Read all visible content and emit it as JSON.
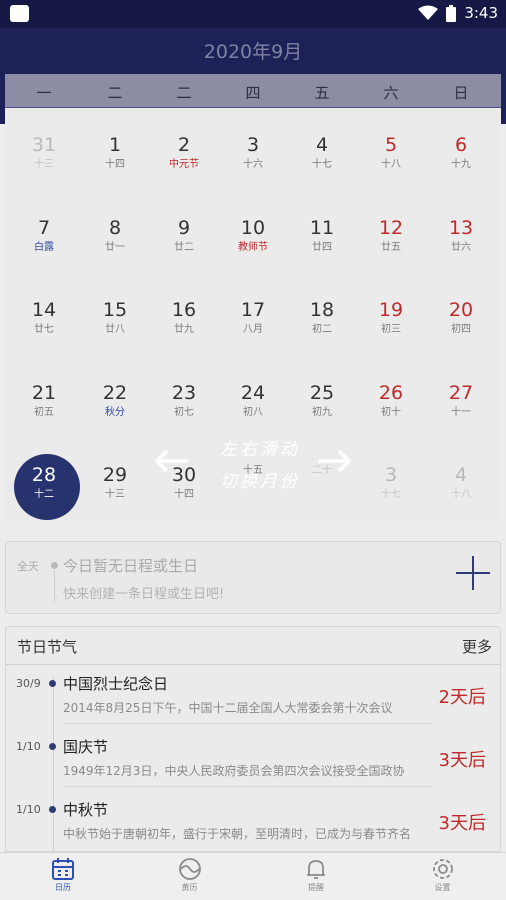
{
  "status": {
    "time": "3:43"
  },
  "header": {
    "month_title": "2020年9月"
  },
  "weekdays": [
    "一",
    "二",
    "二",
    "四",
    "五",
    "六",
    "日"
  ],
  "days": [
    {
      "num": "31",
      "sub": "十三",
      "other": true
    },
    {
      "num": "1",
      "sub": "十四"
    },
    {
      "num": "2",
      "sub": "中元节",
      "sub_style": "festival"
    },
    {
      "num": "3",
      "sub": "十六"
    },
    {
      "num": "4",
      "sub": "十七"
    },
    {
      "num": "5",
      "sub": "十八",
      "weekend": true
    },
    {
      "num": "6",
      "sub": "十九",
      "weekend": true
    },
    {
      "num": "7",
      "sub": "白露",
      "sub_style": "term"
    },
    {
      "num": "8",
      "sub": "廿一"
    },
    {
      "num": "9",
      "sub": "廿二"
    },
    {
      "num": "10",
      "sub": "教师节",
      "sub_style": "festival"
    },
    {
      "num": "11",
      "sub": "廿四"
    },
    {
      "num": "12",
      "sub": "廿五",
      "weekend": true
    },
    {
      "num": "13",
      "sub": "廿六",
      "weekend": true
    },
    {
      "num": "14",
      "sub": "廿七"
    },
    {
      "num": "15",
      "sub": "廿八"
    },
    {
      "num": "16",
      "sub": "廿九"
    },
    {
      "num": "17",
      "sub": "八月"
    },
    {
      "num": "18",
      "sub": "初二"
    },
    {
      "num": "19",
      "sub": "初三",
      "weekend": true
    },
    {
      "num": "20",
      "sub": "初四",
      "weekend": true
    },
    {
      "num": "21",
      "sub": "初五"
    },
    {
      "num": "22",
      "sub": "秋分",
      "sub_style": "term"
    },
    {
      "num": "23",
      "sub": "初七"
    },
    {
      "num": "24",
      "sub": "初八"
    },
    {
      "num": "25",
      "sub": "初九"
    },
    {
      "num": "26",
      "sub": "初十",
      "weekend": true
    },
    {
      "num": "27",
      "sub": "十一",
      "weekend": true
    },
    {
      "num": "28",
      "sub": "十二",
      "today": true
    },
    {
      "num": "29",
      "sub": "十三"
    },
    {
      "num": "30",
      "sub": "十四"
    },
    {
      "num": "",
      "sub": "十五"
    },
    {
      "num": "",
      "sub": "二十",
      "other": true
    },
    {
      "num": "3",
      "sub": "十七",
      "other": true
    },
    {
      "num": "4",
      "sub": "十八",
      "other": true
    }
  ],
  "hint": {
    "line1": "左右滑动",
    "line2": "切换月份"
  },
  "schedule": {
    "allday": "全天",
    "title": "今日暂无日程或生日",
    "subtitle": "快来创建一条日程或生日吧!"
  },
  "festivals": {
    "title": "节日节气",
    "more": "更多",
    "items": [
      {
        "date": "30/9",
        "name": "中国烈士纪念日",
        "desc": "2014年8月25日下午，中国十二届全国人大常委会第十次会议",
        "countdown": "2天后"
      },
      {
        "date": "1/10",
        "name": "国庆节",
        "desc": "1949年12月3日，中央人民政府委员会第四次会议接受全国政协",
        "countdown": "3天后"
      },
      {
        "date": "1/10",
        "name": "中秋节",
        "desc": "中秋节始于唐朝初年，盛行于宋朝，至明清时，已成为与春节齐名",
        "countdown": "3天后"
      }
    ]
  },
  "tabs": [
    {
      "label": "日历",
      "icon": "calendar-icon",
      "active": true
    },
    {
      "label": "黄历",
      "icon": "almanac-icon"
    },
    {
      "label": "提醒",
      "icon": "bell-icon"
    },
    {
      "label": "设置",
      "icon": "gear-icon"
    }
  ],
  "colors": {
    "header_bg": "#1d2157",
    "accent": "#2f3a78",
    "festival_red": "#c02a2a"
  }
}
